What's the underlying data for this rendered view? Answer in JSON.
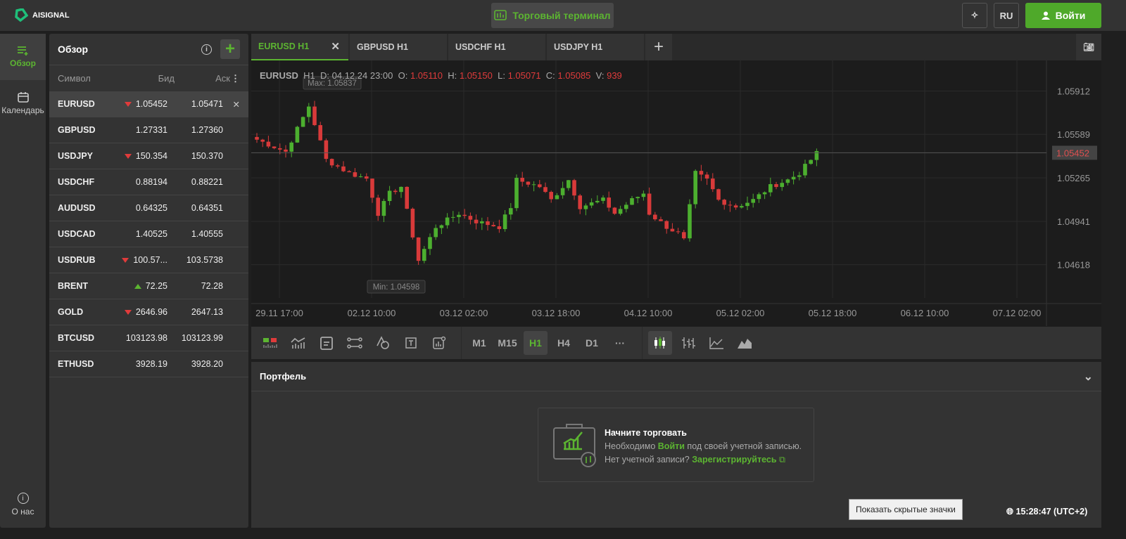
{
  "header": {
    "brand": "AISIGNAL",
    "terminal_label": "Торговый терминал",
    "lang": "RU",
    "login_label": "Войти"
  },
  "sidebar": {
    "items": [
      {
        "label": "Обзор"
      },
      {
        "label": "Календарь"
      }
    ],
    "about": "О нас"
  },
  "watchlist": {
    "title": "Обзор",
    "columns": [
      "Символ",
      "Бид",
      "Аск"
    ],
    "rows": [
      {
        "symbol": "EURUSD",
        "bid": "1.05452",
        "ask": "1.05471",
        "dir": "down"
      },
      {
        "symbol": "GBPUSD",
        "bid": "1.27331",
        "ask": "1.27360",
        "dir": ""
      },
      {
        "symbol": "USDJPY",
        "bid": "150.354",
        "ask": "150.370",
        "dir": "down"
      },
      {
        "symbol": "USDCHF",
        "bid": "0.88194",
        "ask": "0.88221",
        "dir": ""
      },
      {
        "symbol": "AUDUSD",
        "bid": "0.64325",
        "ask": "0.64351",
        "dir": ""
      },
      {
        "symbol": "USDCAD",
        "bid": "1.40525",
        "ask": "1.40555",
        "dir": ""
      },
      {
        "symbol": "USDRUB",
        "bid": "100.57...",
        "ask": "103.5738",
        "dir": "down"
      },
      {
        "symbol": "BRENT",
        "bid": "72.25",
        "ask": "72.28",
        "dir": "up"
      },
      {
        "symbol": "GOLD",
        "bid": "2646.96",
        "ask": "2647.13",
        "dir": "down"
      },
      {
        "symbol": "BTCUSD",
        "bid": "103123.98",
        "ask": "103123.99",
        "dir": ""
      },
      {
        "symbol": "ETHUSD",
        "bid": "3928.19",
        "ask": "3928.20",
        "dir": ""
      }
    ]
  },
  "tabs": [
    "EURUSD H1",
    "GBPUSD H1",
    "USDCHF H1",
    "USDJPY H1"
  ],
  "legend": {
    "symbol": "EURUSD",
    "tf": "H1",
    "d_label": "D:",
    "d": "04.12.24 23:00",
    "o_label": "O:",
    "o": "1.05110",
    "h_label": "H:",
    "h": "1.05150",
    "l_label": "L:",
    "l": "1.05071",
    "c_label": "C:",
    "c": "1.05085",
    "v_label": "V:",
    "v": "939"
  },
  "chart_data": {
    "type": "candlestick",
    "ylim": [
      1.0437,
      1.0614
    ],
    "yticks": [
      "1.05912",
      "1.05589",
      "1.05265",
      "1.04941",
      "1.04618"
    ],
    "xticks": [
      "29.11 17:00",
      "02.12 10:00",
      "03.12 02:00",
      "03.12 18:00",
      "04.12 10:00",
      "05.12 02:00",
      "05.12 18:00",
      "06.12 10:00",
      "07.12 02:00"
    ],
    "last_price": "1.05452",
    "max_label": "Max: 1.05837",
    "min_label": "Min: 1.04598",
    "keypoints": [
      [
        0,
        1.0555
      ],
      [
        5,
        1.0546
      ],
      [
        9,
        1.058
      ],
      [
        12,
        1.054
      ],
      [
        16,
        1.053
      ],
      [
        19,
        1.0526
      ],
      [
        21,
        1.05
      ],
      [
        23,
        1.0515
      ],
      [
        25,
        1.052
      ],
      [
        28,
        1.0465
      ],
      [
        31,
        1.049
      ],
      [
        35,
        1.05
      ],
      [
        38,
        1.0494
      ],
      [
        42,
        1.049
      ],
      [
        44,
        1.0505
      ],
      [
        45,
        1.0525
      ],
      [
        49,
        1.052
      ],
      [
        51,
        1.051
      ],
      [
        54,
        1.0525
      ],
      [
        56,
        1.0505
      ],
      [
        60,
        1.051
      ],
      [
        62,
        1.05
      ],
      [
        65,
        1.051
      ],
      [
        67,
        1.0515
      ],
      [
        68,
        1.05
      ],
      [
        71,
        1.049
      ],
      [
        73,
        1.0485
      ],
      [
        74,
        1.048
      ],
      [
        76,
        1.053
      ],
      [
        78,
        1.0525
      ],
      [
        80,
        1.051
      ],
      [
        83,
        1.0505
      ],
      [
        86,
        1.051
      ],
      [
        89,
        1.052
      ],
      [
        92,
        1.0525
      ],
      [
        94,
        1.053
      ],
      [
        97,
        1.0545
      ]
    ]
  },
  "toolbar": {
    "timeframes": [
      "M1",
      "M15",
      "H1",
      "H4",
      "D1",
      "···"
    ],
    "active": "H1"
  },
  "portfolio": {
    "title": "Портфель",
    "cta_title": "Начните торговать",
    "line1_pre": "Необходимо",
    "line1_link": "Войти",
    "line1_post": "под своей учетной записью.",
    "line2_pre": "Нет учетной записи?",
    "line2_link": "Зарегистрируйтесь"
  },
  "status": {
    "tooltip": "Показать скрытые значки",
    "clock": "15:28:47 (UTC+2)"
  }
}
